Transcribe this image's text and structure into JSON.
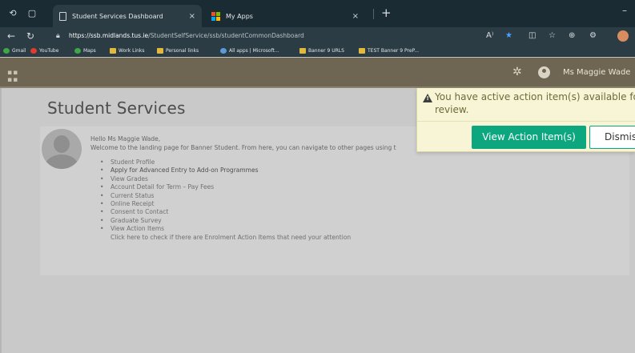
{
  "browser": {
    "tabs": [
      {
        "label": "Student Services Dashboard",
        "close": "×"
      },
      {
        "label": "My Apps",
        "close": "×"
      }
    ],
    "new_tab": "+",
    "minimize": "–",
    "url_host": "https://ssb.midlands.tus.ie",
    "url_path": "/StudentSelfService/ssb/studentCommonDashboard",
    "read_aloud": "A⁾",
    "bookmarks": [
      {
        "label": "Gmail",
        "icon": "gmail-icon"
      },
      {
        "label": "YouTube",
        "icon": "youtube-icon"
      },
      {
        "label": "Maps",
        "icon": "maps-icon"
      },
      {
        "label": "Work Links",
        "icon": "folder-icon"
      },
      {
        "label": "Personal links",
        "icon": "folder-icon"
      },
      {
        "label": "All apps | Microsoft...",
        "icon": "microsoft-icon"
      },
      {
        "label": "Banner 9 URLS",
        "icon": "folder-icon"
      },
      {
        "label": "TEST Banner 9 PreP...",
        "icon": "folder-icon"
      }
    ]
  },
  "header": {
    "user_name": "Ms Maggie Wade"
  },
  "page": {
    "title": "Student Services",
    "greeting": "Hello Ms Maggie Wade,",
    "welcome": "Welcome to the landing page for Banner Student. From here, you can navigate to other pages using t",
    "links": [
      "Student Profile",
      "Apply for Advanced Entry to Add-on Programmes",
      "View Grades",
      "Account Detail for Term – Pay Fees",
      "Current Status",
      "Online Receipt",
      "Consent to Contact",
      "Graduate Survey",
      "View Action Items"
    ],
    "hint": "Click here to check if there are Enrolment Action Items that need your attention"
  },
  "notification": {
    "line1": "You have active action item(s) available for yo",
    "line2": "review.",
    "view_label": "View Action Item(s)",
    "dismiss_label": "Dismiss"
  },
  "colors": {
    "header": "#6e6652",
    "accent": "#0da77f",
    "notify_bg": "#f7f5d6"
  }
}
